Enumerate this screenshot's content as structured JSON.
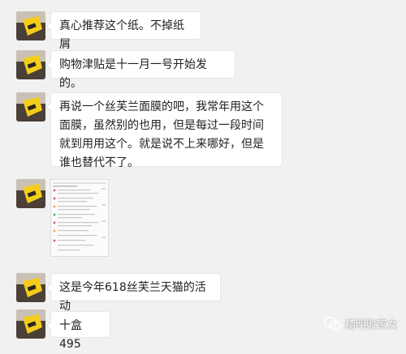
{
  "messages": [
    {
      "text": "真心推荐这个纸。不掉纸屑"
    },
    {
      "text": "购物津贴是十一月一号开始发的。"
    },
    {
      "text": "再说一个丝芙兰面膜的吧，我常年用这个面膜，虽然别的也用，但是每过一段时间就到用用这个。就是说不上来哪好，但是谁也替代不了。"
    },
    {
      "image": "screenshot-image"
    },
    {
      "text": "这是今年618丝芙兰天猫的活动"
    },
    {
      "text": "十盒495"
    }
  ],
  "watermark": {
    "text": "精明败家女"
  },
  "colors": {
    "background": "#f1f1f1",
    "bubble": "#ffffff",
    "avatar_yellow": "#f2cd1c",
    "avatar_dark": "#4a4038"
  }
}
